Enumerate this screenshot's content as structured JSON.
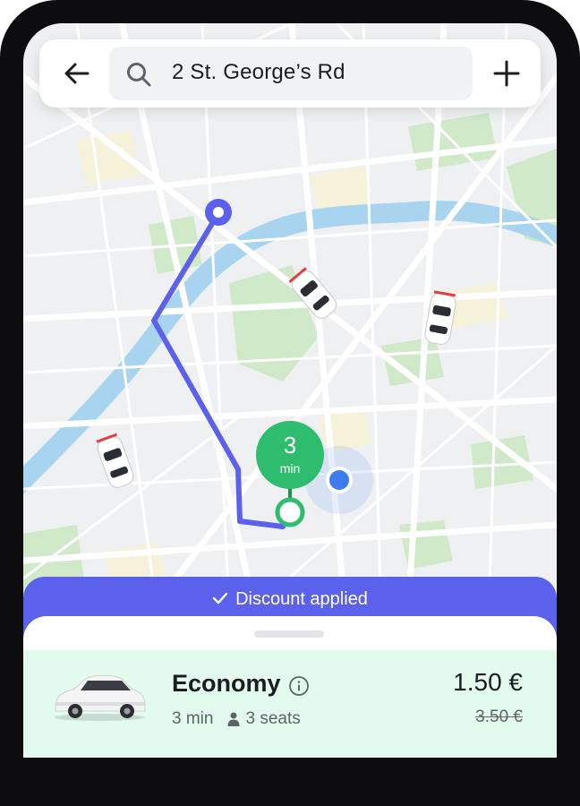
{
  "search": {
    "address": "2 St. George’s Rd",
    "icons": {
      "back": "arrow-left-icon",
      "search": "search-icon",
      "add": "plus-icon"
    }
  },
  "map": {
    "eta_value": "3",
    "eta_unit": "min",
    "colors": {
      "route": "#5b61ea",
      "river": "#a9d4ef",
      "park": "#cfe9c9",
      "pickup": "#2ebd6e",
      "user_location": "#3d7cf0"
    }
  },
  "discount": {
    "label": "Discount applied",
    "icon": "checkmark-icon"
  },
  "ride_option": {
    "name": "Economy",
    "eta": "3 min",
    "seats": "3 seats",
    "price": "1.50 €",
    "old_price": "3.50 €",
    "icons": {
      "info": "info-icon",
      "seats": "person-icon",
      "car": "car-icon"
    }
  }
}
